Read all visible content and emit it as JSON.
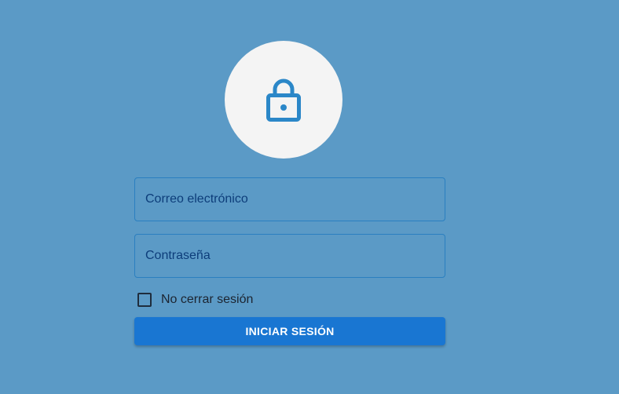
{
  "login": {
    "avatar_icon": "lock-icon",
    "email": {
      "placeholder": "Correo electrónico",
      "value": ""
    },
    "password": {
      "placeholder": "Contraseña",
      "value": ""
    },
    "remember": {
      "label": "No cerrar sesión",
      "checked": false
    },
    "submit_label": "INICIAR SESIÓN"
  },
  "colors": {
    "background": "#5b9ac6",
    "accent": "#1976d2",
    "icon": "#2b87c8",
    "avatar_bg": "#f4f4f4"
  }
}
